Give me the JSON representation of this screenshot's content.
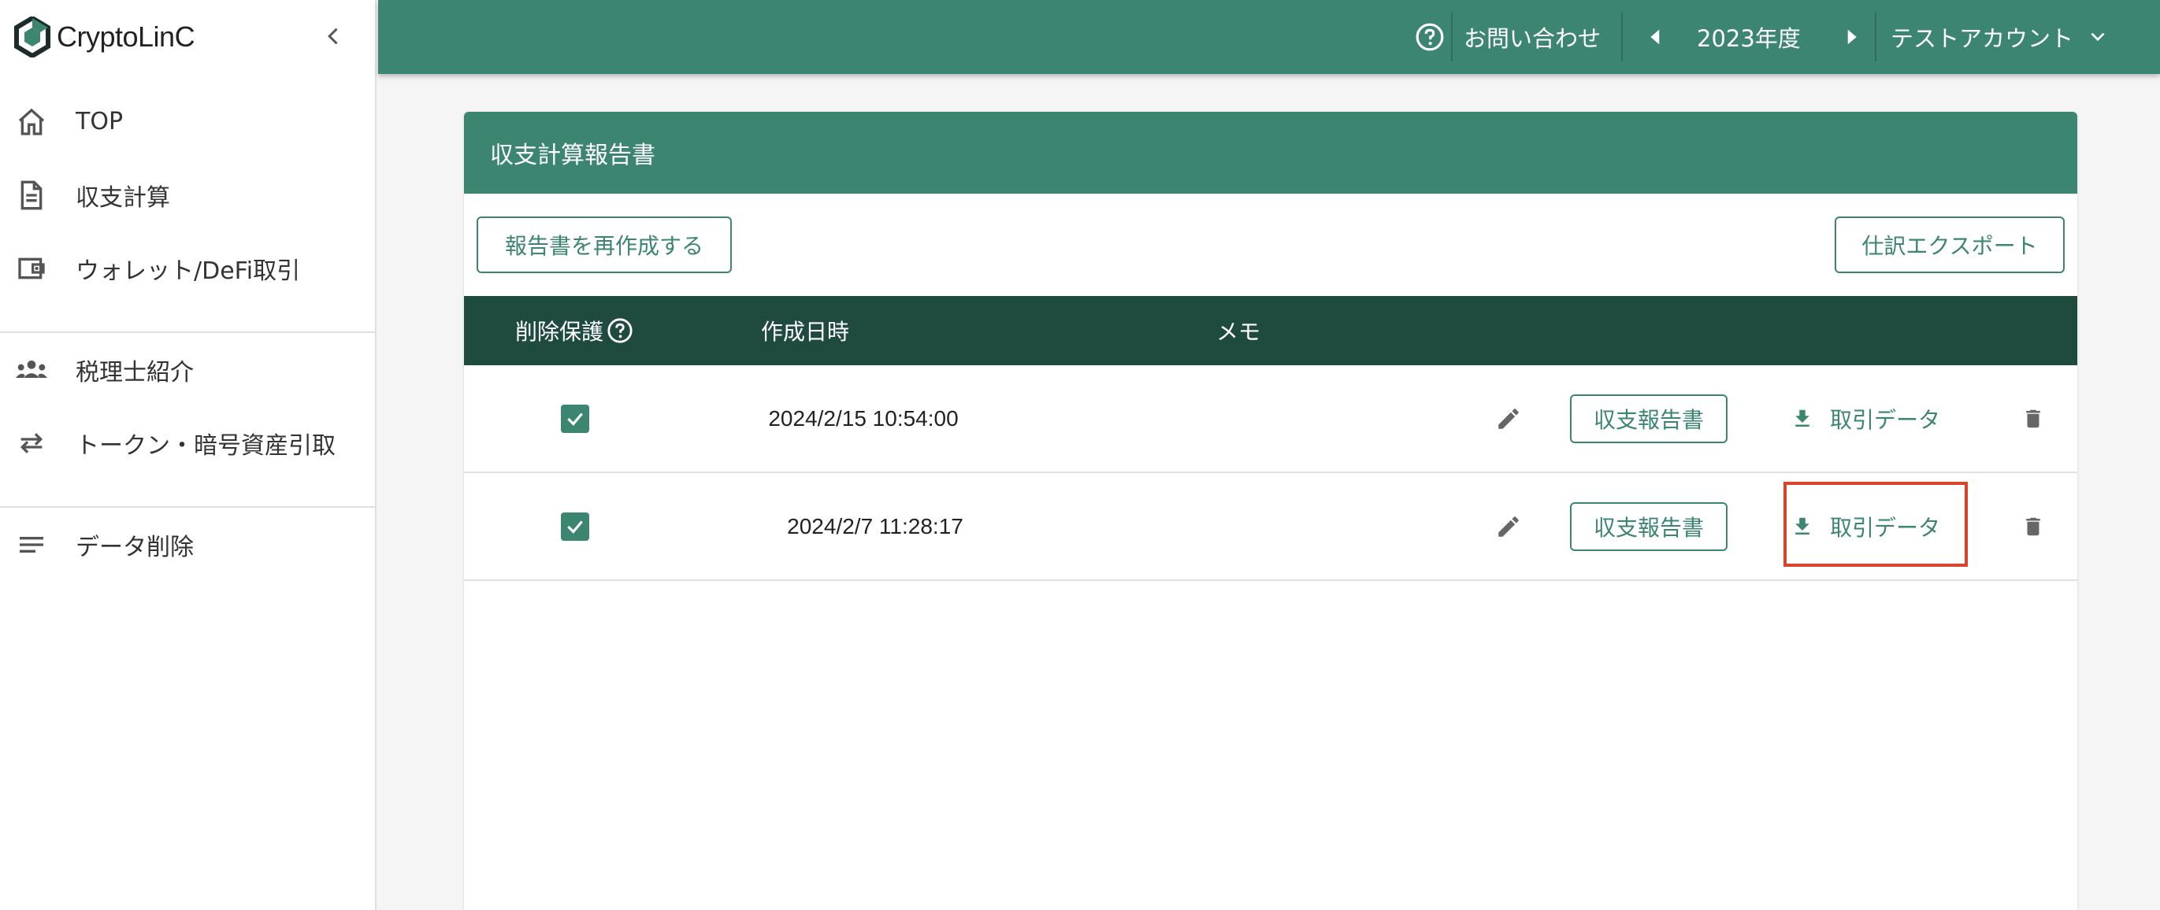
{
  "app": {
    "name": "CryptoLinC"
  },
  "sidebar": {
    "items": [
      {
        "label": "TOP",
        "icon": "home-icon"
      },
      {
        "label": "収支計算",
        "icon": "document-icon"
      },
      {
        "label": "ウォレット/DeFi取引",
        "icon": "wallet-icon"
      },
      {
        "label": "税理士紹介",
        "icon": "people-icon"
      },
      {
        "label": "トークン・暗号資産引取",
        "icon": "swap-icon"
      },
      {
        "label": "データ削除",
        "icon": "lines-icon"
      }
    ]
  },
  "topbar": {
    "contact_label": "お問い合わせ",
    "year_label": "2023年度",
    "account_label": "テストアカウント"
  },
  "card": {
    "title": "収支計算報告書",
    "regenerate_label": "報告書を再作成する",
    "export_label": "仕訳エクスポート"
  },
  "table": {
    "headers": {
      "protect": "削除保護",
      "created": "作成日時",
      "memo": "メモ"
    },
    "rows": [
      {
        "protected": true,
        "created": "2024/2/15 10:54:00",
        "memo": "",
        "report_label": "収支報告書",
        "trade_label": "取引データ"
      },
      {
        "protected": true,
        "created": "2024/2/7 11:28:17",
        "memo": "",
        "report_label": "収支報告書",
        "trade_label": "取引データ"
      }
    ]
  },
  "colors": {
    "primary": "#3c8570",
    "table_header": "#1f4b3f",
    "highlight": "#d9432a"
  }
}
